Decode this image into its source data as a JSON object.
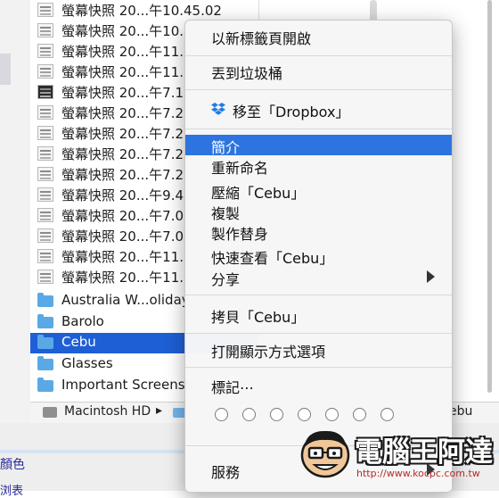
{
  "finder": {
    "rows": [
      {
        "label": "螢幕快照 20...午10.45.02",
        "icon": "screenshot-icon",
        "selected": false
      },
      {
        "label": "螢幕快照 20...午10.",
        "icon": "screenshot-icon",
        "selected": false
      },
      {
        "label": "螢幕快照 20...午11.",
        "icon": "screenshot-icon",
        "selected": false
      },
      {
        "label": "螢幕快照 20...午11.",
        "icon": "screenshot-icon",
        "selected": false
      },
      {
        "label": "螢幕快照 20...午7.1",
        "icon": "screenshot-icon",
        "selected": false
      },
      {
        "label": "螢幕快照 20...午7.2",
        "icon": "screenshot-icon",
        "selected": false
      },
      {
        "label": "螢幕快照 20...午7.2",
        "icon": "screenshot-icon",
        "selected": false
      },
      {
        "label": "螢幕快照 20...午7.2",
        "icon": "screenshot-icon",
        "selected": false
      },
      {
        "label": "螢幕快照 20...午7.2",
        "icon": "screenshot-icon",
        "selected": false
      },
      {
        "label": "螢幕快照 20...午9.4",
        "icon": "screenshot-icon",
        "selected": false
      },
      {
        "label": "螢幕快照 20...午7.0",
        "icon": "screenshot-icon",
        "selected": false
      },
      {
        "label": "螢幕快照 20...午7.0",
        "icon": "screenshot-icon",
        "selected": false
      },
      {
        "label": "螢幕快照 20...午11.",
        "icon": "screenshot-icon",
        "selected": false
      },
      {
        "label": "螢幕快照 20...午11.",
        "icon": "screenshot-icon",
        "selected": false
      },
      {
        "label": "Australia W...oliday",
        "icon": "folder-icon",
        "selected": false
      },
      {
        "label": "Barolo",
        "icon": "folder-icon",
        "selected": false
      },
      {
        "label": "Cebu",
        "icon": "folder-icon",
        "selected": true
      },
      {
        "label": "Glasses",
        "icon": "folder-icon",
        "selected": false
      },
      {
        "label": "Important Screensh",
        "icon": "folder-icon",
        "selected": false
      }
    ],
    "pathbar": {
      "disk_label": "Macintosh HD",
      "chevron": "▸",
      "current": "ebu"
    },
    "selection_color": "#1e5fd6"
  },
  "lower_page": {
    "line1": "顏色",
    "line2": "浏表"
  },
  "context_menu": {
    "highlight_color": "#2d74e0",
    "items": [
      {
        "label": "以新標籤頁開啟"
      },
      {
        "label": "丟到垃圾桶"
      },
      {
        "label": "移至「Dropbox」",
        "icon": "dropbox-icon"
      },
      {
        "label": "簡介",
        "highlighted": true
      },
      {
        "label": "重新命名"
      },
      {
        "label": "壓縮「Cebu」"
      },
      {
        "label": "複製"
      },
      {
        "label": "製作替身"
      },
      {
        "label": "快速查看「Cebu」"
      },
      {
        "label": "分享",
        "submenu": true
      },
      {
        "label": "拷貝「Cebu」"
      },
      {
        "label": "打開顯示方式選項"
      },
      {
        "label": "標記⋯"
      },
      {
        "label": "服務",
        "submenu": true
      }
    ],
    "tag_colors": [
      "#ffffff",
      "#ffffff",
      "#ffffff",
      "#ffffff",
      "#ffffff",
      "#ffffff",
      "#ffffff"
    ]
  },
  "watermark": {
    "title": "電腦王阿達",
    "url": "http://www.kocpc.com.tw"
  }
}
